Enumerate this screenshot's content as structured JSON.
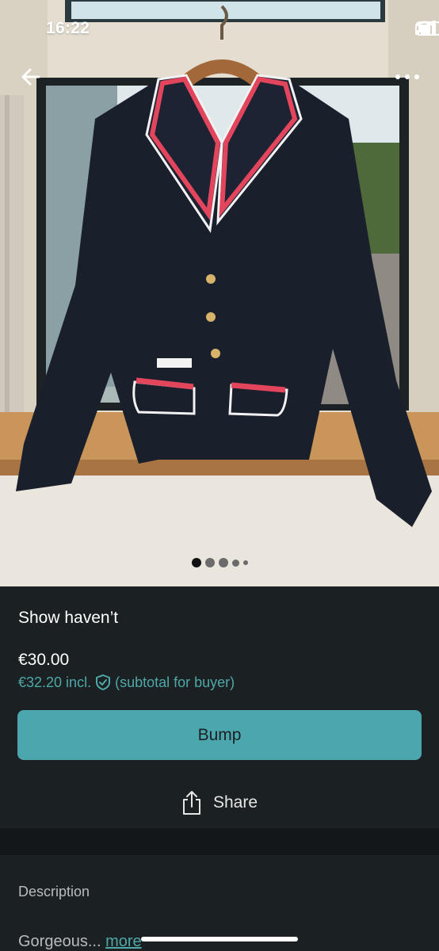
{
  "status_bar": {
    "time": "16:22"
  },
  "photo": {
    "pager_count": 5,
    "pager_active_index": 0
  },
  "listing": {
    "title": "Show haven’t",
    "price": "€30.00",
    "price_incl": "€32.20 incl.",
    "price_incl_note": "(subtotal for buyer)",
    "bump_label": "Bump",
    "share_label": "Share"
  },
  "description": {
    "heading": "Description",
    "text": "Gorgeous...",
    "more_label": "more"
  },
  "colors": {
    "background": "#1b2023",
    "accent_teal": "#4ba6ad",
    "link_teal": "#4fa8a8"
  },
  "icons": [
    "back-arrow-icon",
    "more-dots-icon",
    "signal-icon",
    "wifi-icon",
    "battery-icon",
    "shield-check-icon",
    "share-icon"
  ]
}
